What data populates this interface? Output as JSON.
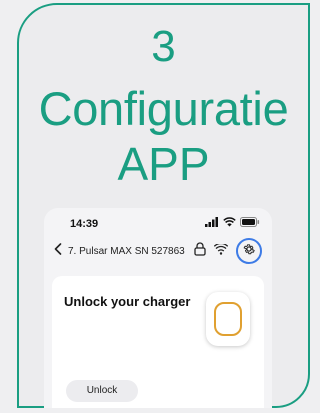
{
  "slide": {
    "step_number": "3",
    "title_line1": "Configuratie",
    "title_line2": "APP",
    "accent_color": "#1a9e82"
  },
  "phone": {
    "status_bar": {
      "time": "14:39",
      "icons": [
        "signal-icon",
        "wifi-icon",
        "battery-icon"
      ]
    },
    "nav": {
      "back_icon": "chevron-left-icon",
      "title": "7. Pulsar MAX SN 527863",
      "icons": [
        "lock-icon",
        "wifi-icon",
        "gear-icon"
      ],
      "highlight_color": "#3d7be6"
    },
    "card": {
      "title": "Unlock your charger",
      "charger_icon": "charger-icon",
      "charger_ring_color": "#e0a030",
      "button_label": "Unlock"
    }
  }
}
